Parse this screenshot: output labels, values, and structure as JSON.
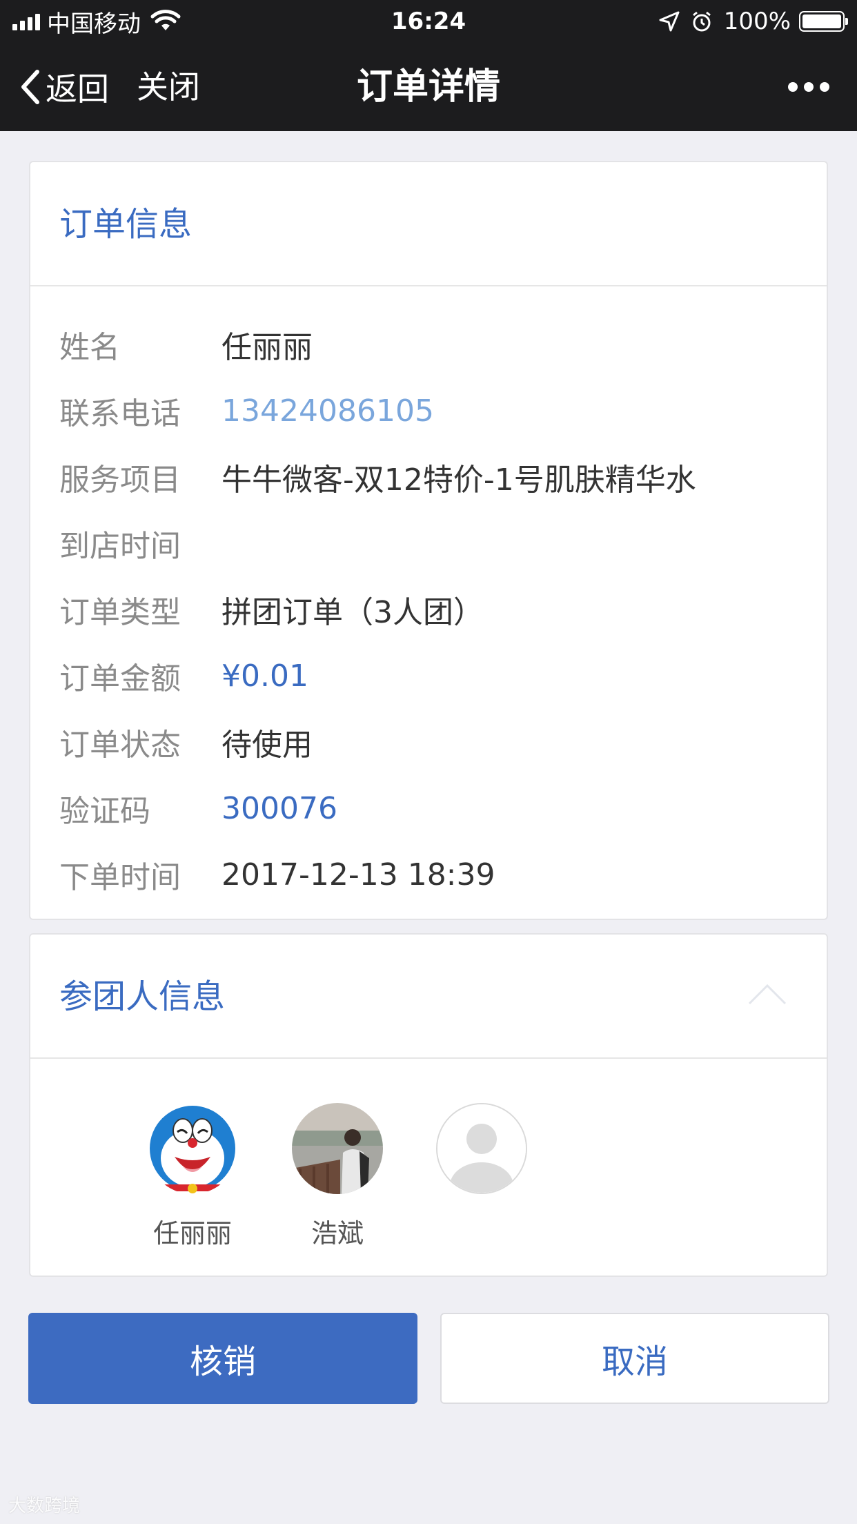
{
  "status_bar": {
    "carrier": "中国移动",
    "time": "16:24",
    "battery": "100%"
  },
  "nav": {
    "back_label": "返回",
    "close_label": "关闭",
    "title": "订单详情"
  },
  "order_info": {
    "title": "订单信息",
    "rows": [
      {
        "label": "姓名",
        "value": "任丽丽"
      },
      {
        "label": "联系电话",
        "value": "13424086105"
      },
      {
        "label": "服务项目",
        "value": "牛牛微客-双12特价-1号肌肤精华水"
      },
      {
        "label": "到店时间",
        "value": ""
      },
      {
        "label": "订单类型",
        "value": "拼团订单（3人团）"
      },
      {
        "label": "订单金额",
        "value": "¥0.01"
      },
      {
        "label": "订单状态",
        "value": "待使用"
      },
      {
        "label": "验证码",
        "value": "300076"
      },
      {
        "label": "下单时间",
        "value": "2017-12-13 18:39"
      }
    ]
  },
  "members_info": {
    "title": "参团人信息",
    "members": [
      {
        "name": "任丽丽",
        "avatar": "doraemon-avatar"
      },
      {
        "name": "浩斌",
        "avatar": "photo-avatar"
      },
      {
        "name": "",
        "avatar": "default-avatar"
      }
    ]
  },
  "actions": {
    "verify_label": "核销",
    "cancel_label": "取消"
  },
  "watermark": "大数跨境",
  "colors": {
    "accent": "#3a6bc1",
    "nav_bg": "#1c1c1e",
    "page_bg": "#efeff4"
  }
}
